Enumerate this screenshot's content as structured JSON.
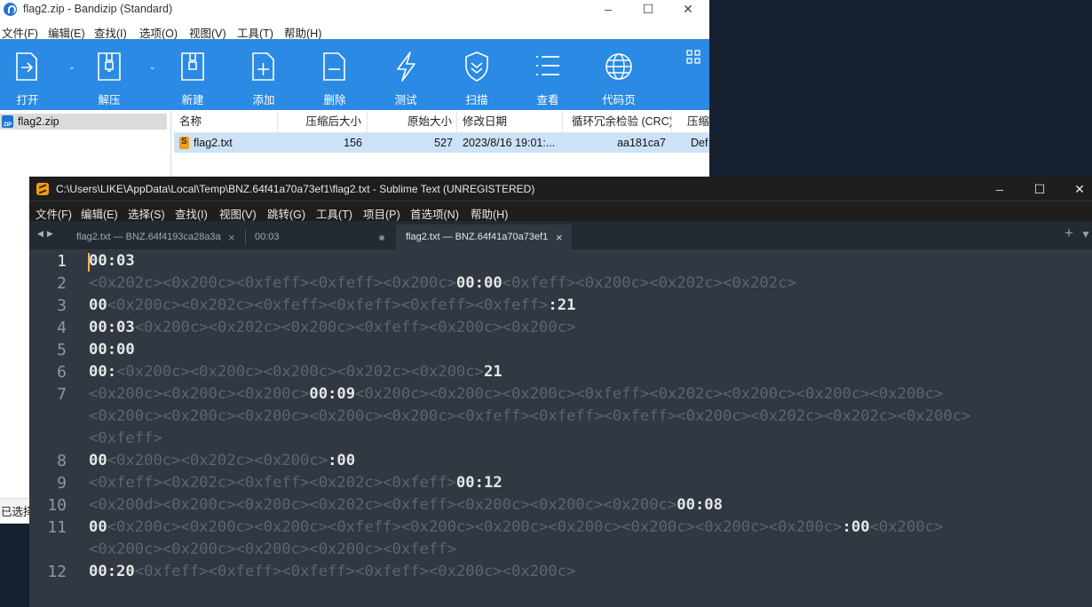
{
  "bandizip": {
    "title": "flag2.zip - Bandizip (Standard)",
    "menu": [
      "文件(F)",
      "编辑(E)",
      "查找(I)",
      "选项(O)",
      "视图(V)",
      "工具(T)",
      "帮助(H)"
    ],
    "toolbar": [
      "打开",
      "解压",
      "新建",
      "添加",
      "删除",
      "测试",
      "扫描",
      "查看",
      "代码页"
    ],
    "tree_item": "flag2.zip",
    "columns": [
      "名称",
      "压缩后大小",
      "原始大小",
      "修改日期",
      "循环冗余检验 (CRC)",
      "压缩"
    ],
    "row": {
      "name": "flag2.txt",
      "packed": "156",
      "size": "527",
      "modified": "2023/8/16 19:01:...",
      "crc": "aa181ca7",
      "method": "Def"
    },
    "status": "已选择"
  },
  "sublime": {
    "title": "C:\\Users\\LIKE\\AppData\\Local\\Temp\\BNZ.64f41a70a73ef1\\flag2.txt - Sublime Text (UNREGISTERED)",
    "menu": [
      "文件(F)",
      "编辑(E)",
      "选择(S)",
      "查找(I)",
      "视图(V)",
      "跳转(G)",
      "工具(T)",
      "项目(P)",
      "首选项(N)",
      "帮助(H)"
    ],
    "tabs": [
      "flag2.txt — BNZ.64f4193ca28a3a",
      "00:03",
      "flag2.txt — BNZ.64f41a70a73ef1"
    ],
    "lines": [
      {
        "n": "1",
        "rows": [
          [
            [
              "v",
              "00:03"
            ]
          ]
        ]
      },
      {
        "n": "2",
        "rows": [
          [
            [
              "g",
              "<0x202c><0x200c><0xfeff><0xfeff><0x200c>"
            ],
            [
              "v",
              "00:00"
            ],
            [
              "g",
              "<0xfeff><0x200c><0x202c><0x202c>"
            ]
          ]
        ]
      },
      {
        "n": "3",
        "rows": [
          [
            [
              "v",
              "00"
            ],
            [
              "g",
              "<0x200c><0x202c><0xfeff><0xfeff><0xfeff><0xfeff>"
            ],
            [
              "v",
              ":21"
            ]
          ]
        ]
      },
      {
        "n": "4",
        "rows": [
          [
            [
              "v",
              "00:03"
            ],
            [
              "g",
              "<0x200c><0x202c><0x200c><0xfeff><0x200c><0x200c>"
            ]
          ]
        ]
      },
      {
        "n": "5",
        "rows": [
          [
            [
              "v",
              "00:00"
            ]
          ]
        ]
      },
      {
        "n": "6",
        "rows": [
          [
            [
              "v",
              "00:"
            ],
            [
              "g",
              "<0x200c><0x200c><0x200c><0x202c><0x200c>"
            ],
            [
              "v",
              "21"
            ]
          ]
        ]
      },
      {
        "n": "7",
        "rows": [
          [
            [
              "g",
              "<0x200c><0x200c><0x200c>"
            ],
            [
              "v",
              "00:09"
            ],
            [
              "g",
              "<0x200c><0x200c><0x200c><0xfeff><0x202c><0x200c><0x200c><0x200c>"
            ]
          ],
          [
            [
              "g",
              "<0x200c><0x200c><0x200c><0x200c><0x200c><0xfeff><0xfeff><0xfeff><0x200c><0x202c><0x202c><0x200c>"
            ]
          ],
          [
            [
              "g",
              "<0xfeff>"
            ]
          ]
        ]
      },
      {
        "n": "8",
        "rows": [
          [
            [
              "v",
              "00"
            ],
            [
              "g",
              "<0x200c><0x202c><0x200c>"
            ],
            [
              "v",
              ":00"
            ]
          ]
        ]
      },
      {
        "n": "9",
        "rows": [
          [
            [
              "g",
              "<0xfeff><0x202c><0xfeff><0x202c><0xfeff>"
            ],
            [
              "v",
              "00:12"
            ]
          ]
        ]
      },
      {
        "n": "10",
        "rows": [
          [
            [
              "g",
              "<0x200d><0x200c><0x200c><0x202c><0xfeff><0x200c><0x200c><0x200c>"
            ],
            [
              "v",
              "00:08"
            ]
          ]
        ]
      },
      {
        "n": "11",
        "rows": [
          [
            [
              "v",
              "00"
            ],
            [
              "g",
              "<0x200c><0x200c><0x200c><0xfeff><0x200c><0x200c><0x200c><0x200c><0x200c><0x200c>"
            ],
            [
              "v",
              ":00"
            ],
            [
              "g",
              "<0x200c>"
            ]
          ],
          [
            [
              "g",
              "<0x200c><0x200c><0x200c><0x200c><0xfeff>"
            ]
          ]
        ]
      },
      {
        "n": "12",
        "rows": [
          [
            [
              "v",
              "00:20"
            ],
            [
              "g",
              "<0xfeff><0xfeff><0xfeff><0xfeff><0x200c><0x200c>"
            ]
          ]
        ]
      }
    ]
  }
}
